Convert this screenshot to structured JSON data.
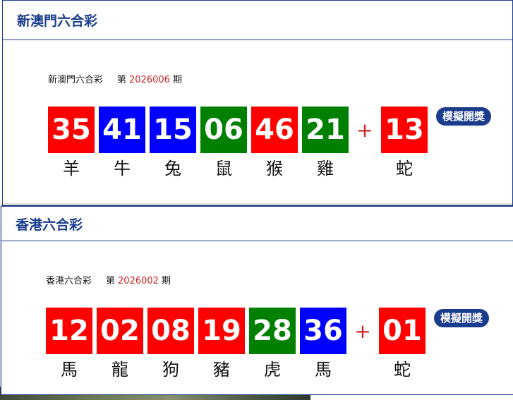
{
  "colors": {
    "red": "#ff0000",
    "blue": "#0000ff",
    "green": "#008000",
    "brand": "#1a3c8c",
    "accent": "#d02020"
  },
  "lotteries": [
    {
      "title": "新澳門六合彩",
      "draw_label": "新澳門六合彩",
      "issue_prefix": "第",
      "issue_number": "2026006",
      "issue_suffix": "期",
      "balls": [
        {
          "number": "35",
          "zodiac": "羊",
          "color": "red"
        },
        {
          "number": "41",
          "zodiac": "牛",
          "color": "blue"
        },
        {
          "number": "15",
          "zodiac": "兔",
          "color": "blue"
        },
        {
          "number": "06",
          "zodiac": "鼠",
          "color": "green"
        },
        {
          "number": "46",
          "zodiac": "猴",
          "color": "red"
        },
        {
          "number": "21",
          "zodiac": "雞",
          "color": "green"
        }
      ],
      "plus": "+",
      "special": {
        "number": "13",
        "zodiac": "蛇",
        "color": "red"
      },
      "button_label": "模擬開獎"
    },
    {
      "title": "香港六合彩",
      "draw_label": "香港六合彩",
      "issue_prefix": "第",
      "issue_number": "2026002",
      "issue_suffix": "期",
      "balls": [
        {
          "number": "12",
          "zodiac": "馬",
          "color": "red"
        },
        {
          "number": "02",
          "zodiac": "龍",
          "color": "red"
        },
        {
          "number": "08",
          "zodiac": "狗",
          "color": "red"
        },
        {
          "number": "19",
          "zodiac": "豬",
          "color": "red"
        },
        {
          "number": "28",
          "zodiac": "虎",
          "color": "green"
        },
        {
          "number": "36",
          "zodiac": "馬",
          "color": "blue"
        }
      ],
      "plus": "+",
      "special": {
        "number": "01",
        "zodiac": "蛇",
        "color": "red"
      },
      "button_label": "模擬開獎"
    }
  ]
}
